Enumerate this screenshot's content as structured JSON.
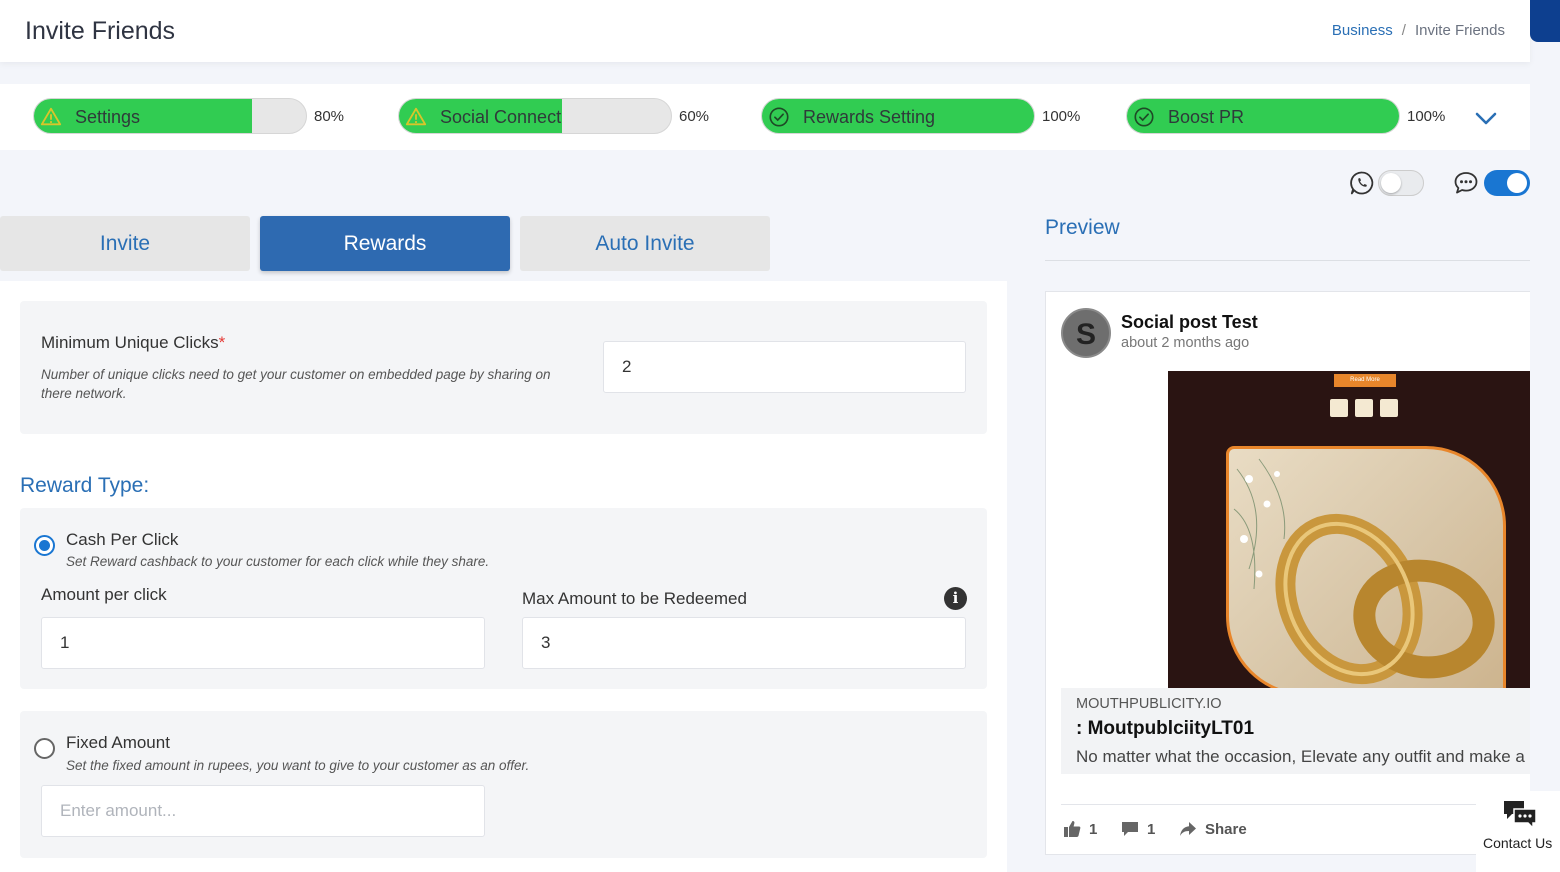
{
  "header": {
    "title": "Invite Friends",
    "breadcrumb": {
      "parent": "Business",
      "separator": "/",
      "current": "Invite Friends"
    }
  },
  "progress_steps": [
    {
      "label": "Settings",
      "percent_label": "80%",
      "fill": 0.8,
      "status_icon": "warning-icon"
    },
    {
      "label": "Social Connect",
      "percent_label": "60%",
      "fill": 0.6,
      "status_icon": "warning-icon"
    },
    {
      "label": "Rewards Setting",
      "percent_label": "100%",
      "fill": 1.0,
      "status_icon": "check-circle-icon"
    },
    {
      "label": "Boost PR",
      "percent_label": "100%",
      "fill": 1.0,
      "status_icon": "check-circle-icon"
    }
  ],
  "channel_toggles": [
    {
      "icon": "whatsapp-icon",
      "enabled": false
    },
    {
      "icon": "chat-bubble-icon",
      "enabled": true
    }
  ],
  "tabs": [
    {
      "label": "Invite",
      "active": false
    },
    {
      "label": "Rewards",
      "active": true
    },
    {
      "label": "Auto Invite",
      "active": false
    }
  ],
  "min_clicks": {
    "label": "Minimum Unique Clicks",
    "required_mark": "*",
    "hint": "Number of unique clicks need to get your customer on embedded page by sharing on there network.",
    "value": "2"
  },
  "reward_type": {
    "heading": "Reward Type:",
    "cash_per_click": {
      "label": "Cash Per Click",
      "hint": "Set Reward cashback to your customer for each click while they share.",
      "selected": true,
      "amount_label": "Amount per click",
      "amount_value": "1",
      "max_label": "Max Amount to be Redeemed",
      "max_value": "3"
    },
    "fixed_amount": {
      "label": "Fixed Amount",
      "hint": "Set the fixed amount in rupees, you want to give to your customer as an offer.",
      "selected": false,
      "placeholder": "Enter amount..."
    }
  },
  "preview": {
    "heading": "Preview",
    "post": {
      "avatar_letter": "S",
      "title": "Social post Test",
      "time": "about 2 months ago",
      "image_button": "Read More",
      "link_domain": "MOUTHPUBLICITY.IO",
      "link_title": ": MoutpublciityLT01",
      "link_desc": "No matter what the occasion, Elevate any outfit and make a",
      "likes": "1",
      "comments": "1",
      "share_label": "Share"
    }
  },
  "contact": {
    "label": "Contact Us"
  },
  "colors": {
    "accent": "#2a6fb5",
    "active_tab": "#2e6ab1",
    "progress": "#31cc52",
    "toggle_on": "#1976d2"
  }
}
